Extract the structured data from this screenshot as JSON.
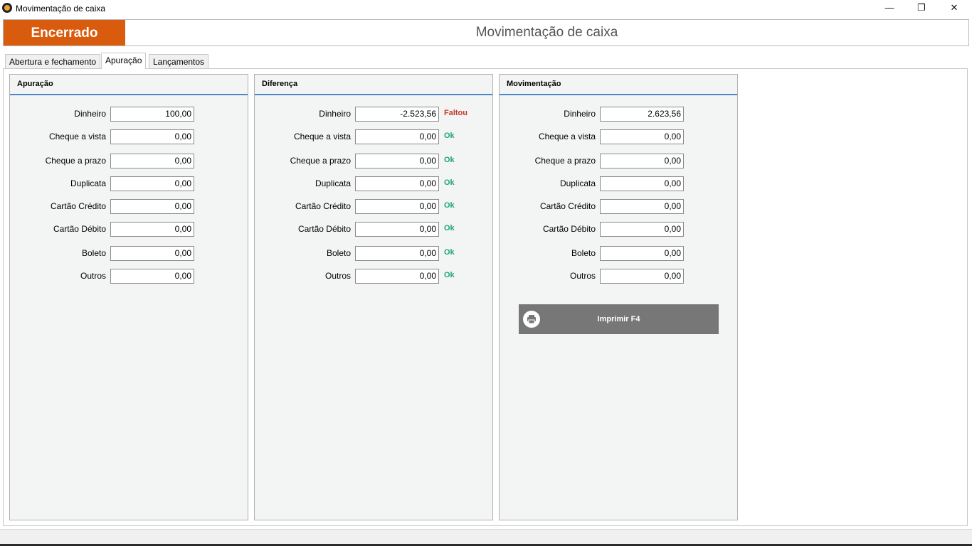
{
  "window": {
    "title": "Movimentação de caixa",
    "minimize": "—",
    "restore": "❐",
    "close": "✕"
  },
  "header": {
    "status": "Encerrado",
    "title": "Movimentação de caixa"
  },
  "tabs": [
    {
      "label": "Abertura e fechamento",
      "active": false
    },
    {
      "label": "Apuração",
      "active": true
    },
    {
      "label": "Lançamentos",
      "active": false
    }
  ],
  "colors": {
    "status_badge": "#d95b0e",
    "accent_line": "#4a86c8",
    "status_bad": "#c0392b",
    "status_ok": "#22a37a",
    "print_button": "#777777"
  },
  "apuracao": {
    "title": "Apuração",
    "rows": [
      {
        "label": "Dinheiro",
        "value": "100,00"
      },
      {
        "label": "Cheque a vista",
        "value": "0,00"
      },
      {
        "label": "Cheque a prazo",
        "value": "0,00"
      },
      {
        "label": "Duplicata",
        "value": "0,00"
      },
      {
        "label": "Cartão Crédito",
        "value": "0,00"
      },
      {
        "label": "Cartão Débito",
        "value": "0,00"
      },
      {
        "label": "Boleto",
        "value": "0,00"
      },
      {
        "label": "Outros",
        "value": "0,00"
      }
    ]
  },
  "diferenca": {
    "title": "Diferença",
    "rows": [
      {
        "label": "Dinheiro",
        "value": "-2.523,56",
        "status": "Faltou"
      },
      {
        "label": "Cheque a vista",
        "value": "0,00",
        "status": "Ok"
      },
      {
        "label": "Cheque a prazo",
        "value": "0,00",
        "status": "Ok"
      },
      {
        "label": "Duplicata",
        "value": "0,00",
        "status": "Ok"
      },
      {
        "label": "Cartão Crédito",
        "value": "0,00",
        "status": "Ok"
      },
      {
        "label": "Cartão Débito",
        "value": "0,00",
        "status": "Ok"
      },
      {
        "label": "Boleto",
        "value": "0,00",
        "status": "Ok"
      },
      {
        "label": "Outros",
        "value": "0,00",
        "status": "Ok"
      }
    ]
  },
  "movimentacao": {
    "title": "Movimentação",
    "rows": [
      {
        "label": "Dinheiro",
        "value": "2.623,56"
      },
      {
        "label": "Cheque a vista",
        "value": "0,00"
      },
      {
        "label": "Cheque a prazo",
        "value": "0,00"
      },
      {
        "label": "Duplicata",
        "value": "0,00"
      },
      {
        "label": "Cartão Crédito",
        "value": "0,00"
      },
      {
        "label": "Cartão Débito",
        "value": "0,00"
      },
      {
        "label": "Boleto",
        "value": "0,00"
      },
      {
        "label": "Outros",
        "value": "0,00"
      }
    ],
    "print_label": "Imprimir F4",
    "print_icon": "printer-icon"
  }
}
